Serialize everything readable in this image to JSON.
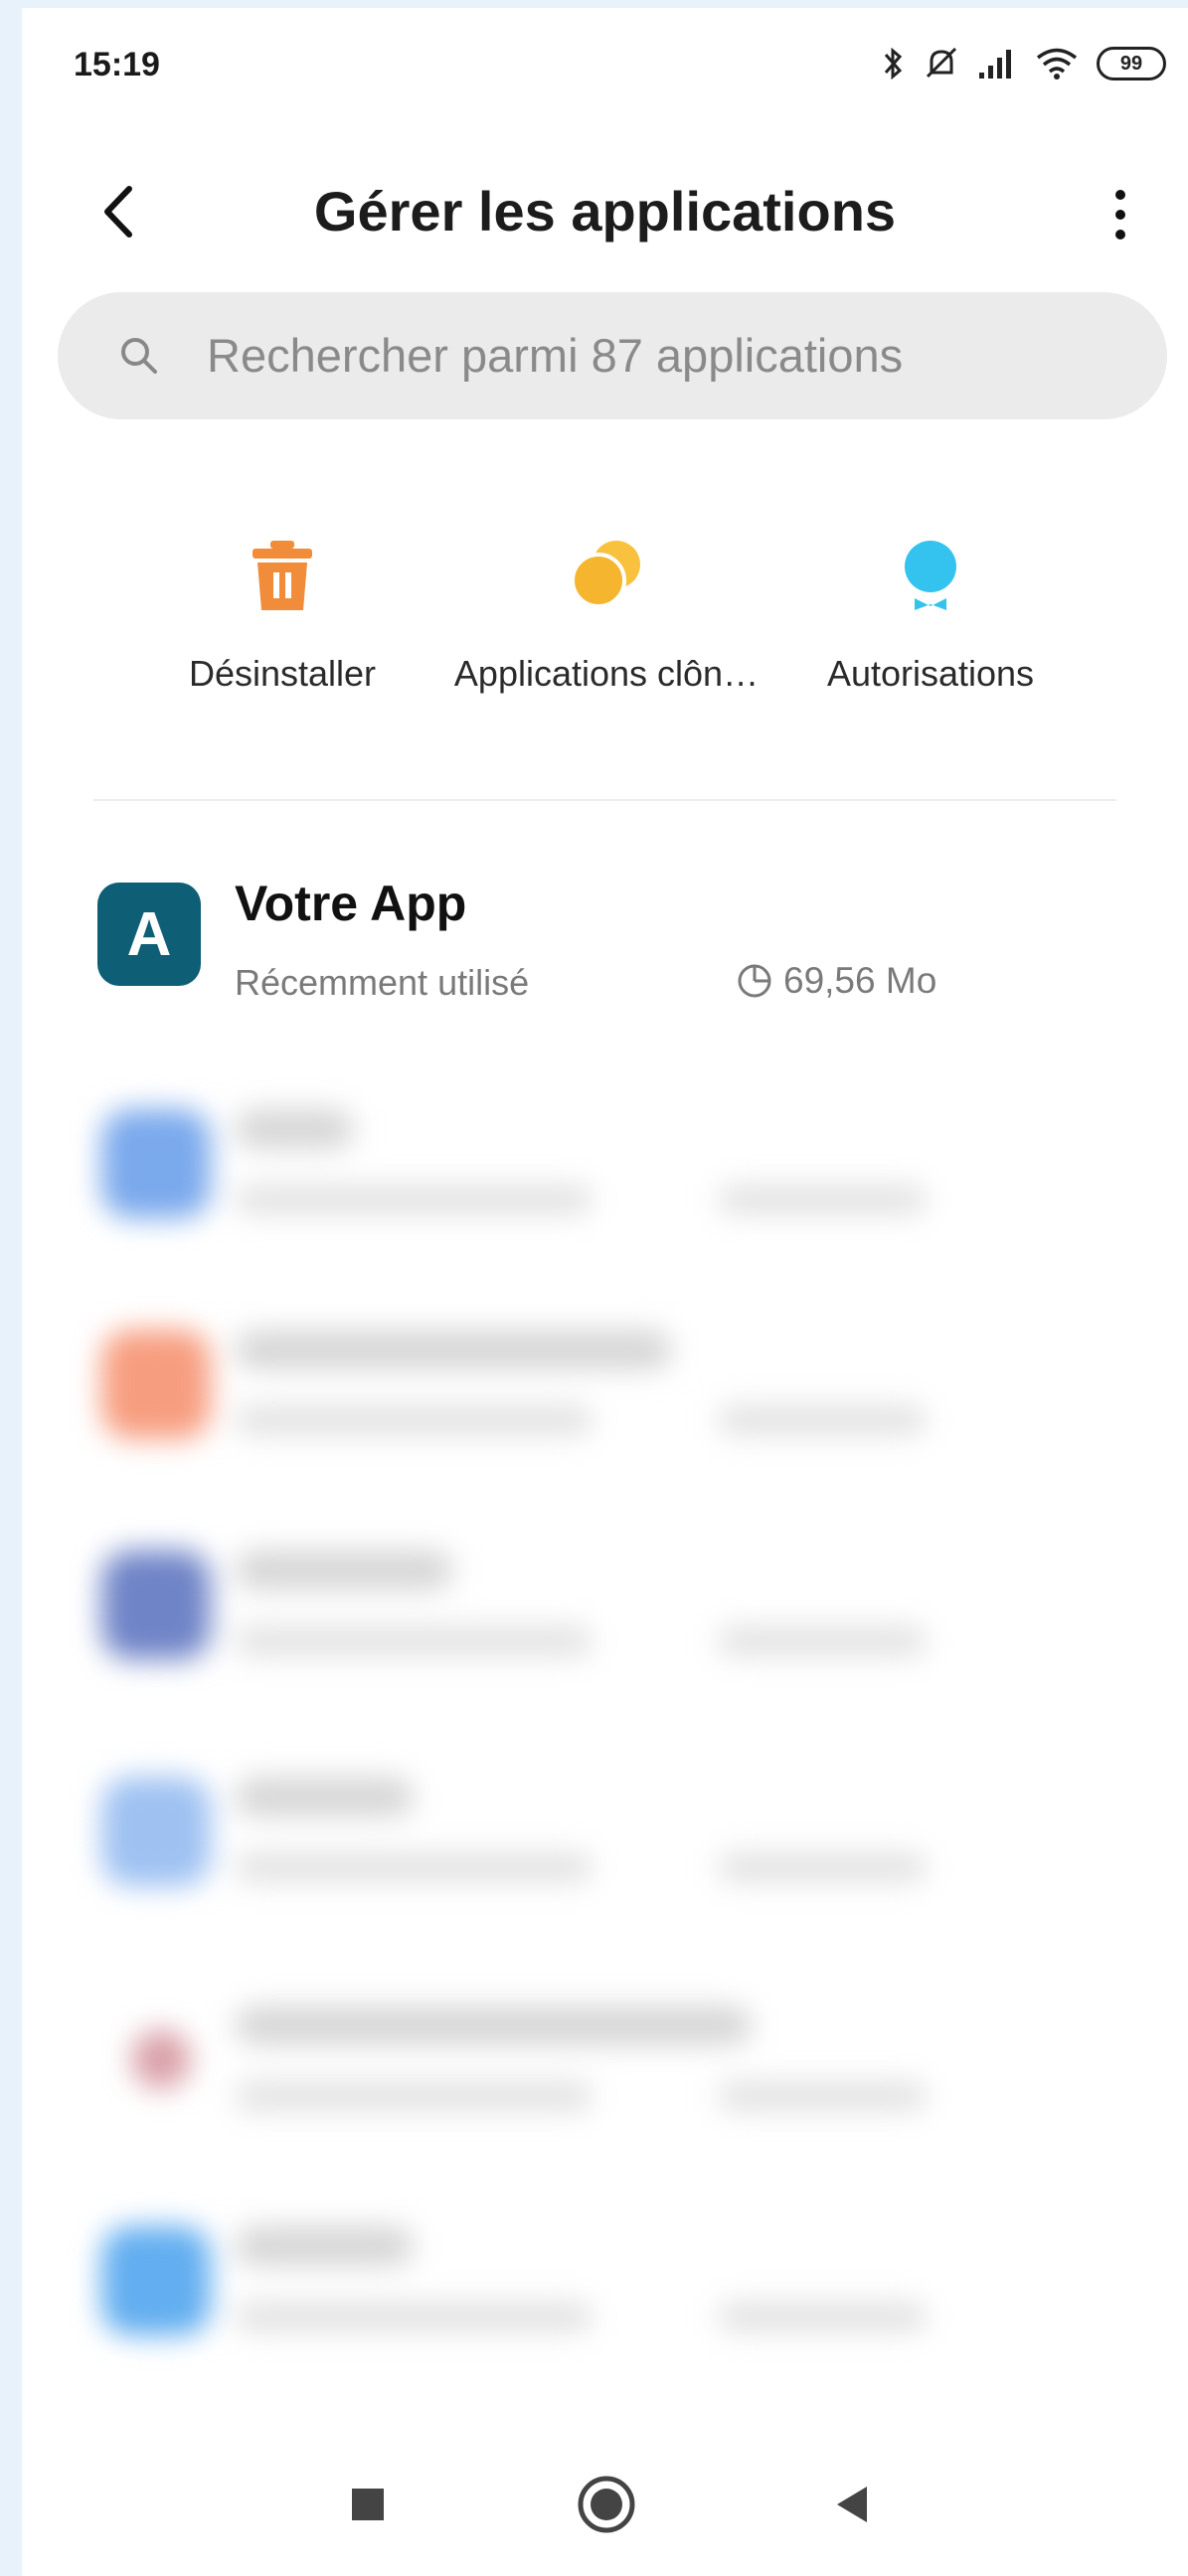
{
  "status_bar": {
    "time": "15:19",
    "battery": "99"
  },
  "header": {
    "title": "Gérer les applications"
  },
  "search": {
    "placeholder": "Rechercher parmi 87 applications"
  },
  "quick_actions": [
    {
      "label": "Désinstaller",
      "icon": "trash-icon",
      "color": "#f08c3a"
    },
    {
      "label": "Applications clôn…",
      "icon": "dual-apps-icon",
      "color": "#f5b52e"
    },
    {
      "label": "Autorisations",
      "icon": "permissions-icon",
      "color": "#33c3ee"
    }
  ],
  "apps": [
    {
      "icon_letter": "A",
      "name": "Votre App",
      "subtitle": "Récemment utilisé",
      "size": "69,56 Mo",
      "icon_color": "#0e5e76"
    }
  ],
  "blurred_apps_colors": [
    "#7aa9ec",
    "#f79d7f",
    "#6f84c7",
    "#9ec1f2",
    "#d9a0a8",
    "#62aef0"
  ]
}
